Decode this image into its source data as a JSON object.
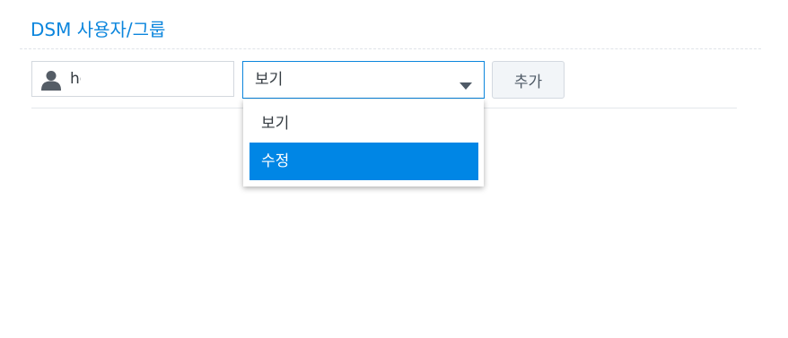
{
  "section": {
    "title": "DSM 사용자/그룹"
  },
  "user_field": {
    "icon": "user-icon",
    "value": "hc"
  },
  "permission_select": {
    "selected": "보기",
    "icon": "chevron-down-icon",
    "options": [
      "보기",
      "수정"
    ],
    "highlighted_option": "수정"
  },
  "add_button": {
    "label": "추가"
  },
  "colors": {
    "accent": "#0c86dd",
    "highlight": "#0086e5",
    "text": "#333a40"
  }
}
